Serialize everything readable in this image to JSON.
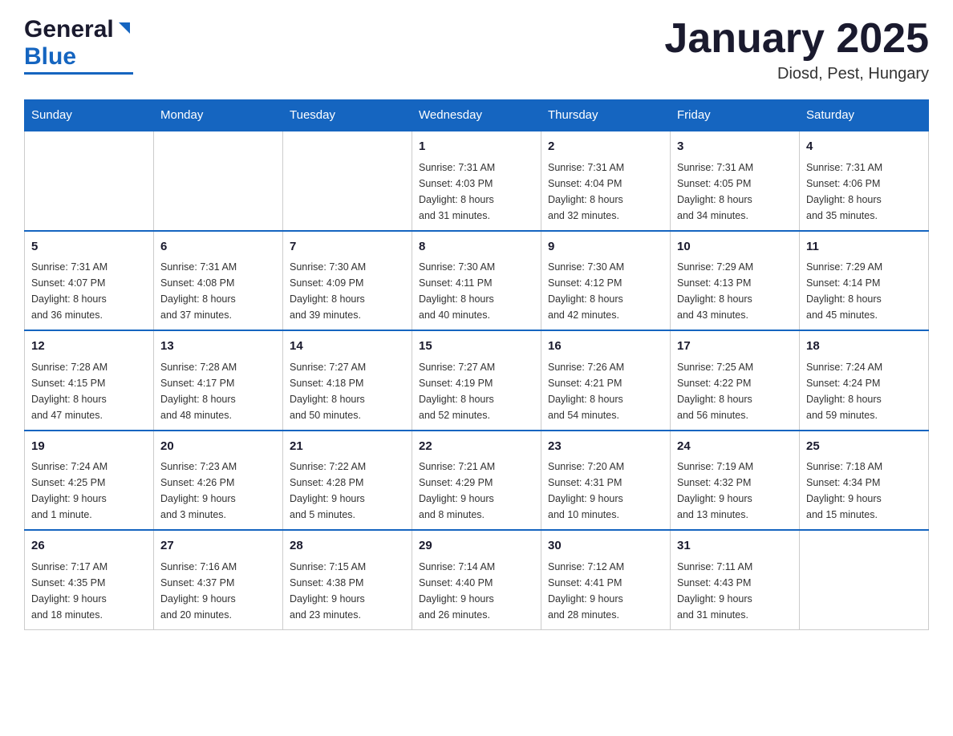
{
  "logo": {
    "general": "General",
    "blue": "Blue",
    "arrow_unicode": "▶"
  },
  "title": "January 2025",
  "subtitle": "Diosd, Pest, Hungary",
  "days_of_week": [
    "Sunday",
    "Monday",
    "Tuesday",
    "Wednesday",
    "Thursday",
    "Friday",
    "Saturday"
  ],
  "weeks": [
    {
      "cells": [
        {
          "day": "",
          "info": ""
        },
        {
          "day": "",
          "info": ""
        },
        {
          "day": "",
          "info": ""
        },
        {
          "day": "1",
          "info": "Sunrise: 7:31 AM\nSunset: 4:03 PM\nDaylight: 8 hours\nand 31 minutes."
        },
        {
          "day": "2",
          "info": "Sunrise: 7:31 AM\nSunset: 4:04 PM\nDaylight: 8 hours\nand 32 minutes."
        },
        {
          "day": "3",
          "info": "Sunrise: 7:31 AM\nSunset: 4:05 PM\nDaylight: 8 hours\nand 34 minutes."
        },
        {
          "day": "4",
          "info": "Sunrise: 7:31 AM\nSunset: 4:06 PM\nDaylight: 8 hours\nand 35 minutes."
        }
      ]
    },
    {
      "cells": [
        {
          "day": "5",
          "info": "Sunrise: 7:31 AM\nSunset: 4:07 PM\nDaylight: 8 hours\nand 36 minutes."
        },
        {
          "day": "6",
          "info": "Sunrise: 7:31 AM\nSunset: 4:08 PM\nDaylight: 8 hours\nand 37 minutes."
        },
        {
          "day": "7",
          "info": "Sunrise: 7:30 AM\nSunset: 4:09 PM\nDaylight: 8 hours\nand 39 minutes."
        },
        {
          "day": "8",
          "info": "Sunrise: 7:30 AM\nSunset: 4:11 PM\nDaylight: 8 hours\nand 40 minutes."
        },
        {
          "day": "9",
          "info": "Sunrise: 7:30 AM\nSunset: 4:12 PM\nDaylight: 8 hours\nand 42 minutes."
        },
        {
          "day": "10",
          "info": "Sunrise: 7:29 AM\nSunset: 4:13 PM\nDaylight: 8 hours\nand 43 minutes."
        },
        {
          "day": "11",
          "info": "Sunrise: 7:29 AM\nSunset: 4:14 PM\nDaylight: 8 hours\nand 45 minutes."
        }
      ]
    },
    {
      "cells": [
        {
          "day": "12",
          "info": "Sunrise: 7:28 AM\nSunset: 4:15 PM\nDaylight: 8 hours\nand 47 minutes."
        },
        {
          "day": "13",
          "info": "Sunrise: 7:28 AM\nSunset: 4:17 PM\nDaylight: 8 hours\nand 48 minutes."
        },
        {
          "day": "14",
          "info": "Sunrise: 7:27 AM\nSunset: 4:18 PM\nDaylight: 8 hours\nand 50 minutes."
        },
        {
          "day": "15",
          "info": "Sunrise: 7:27 AM\nSunset: 4:19 PM\nDaylight: 8 hours\nand 52 minutes."
        },
        {
          "day": "16",
          "info": "Sunrise: 7:26 AM\nSunset: 4:21 PM\nDaylight: 8 hours\nand 54 minutes."
        },
        {
          "day": "17",
          "info": "Sunrise: 7:25 AM\nSunset: 4:22 PM\nDaylight: 8 hours\nand 56 minutes."
        },
        {
          "day": "18",
          "info": "Sunrise: 7:24 AM\nSunset: 4:24 PM\nDaylight: 8 hours\nand 59 minutes."
        }
      ]
    },
    {
      "cells": [
        {
          "day": "19",
          "info": "Sunrise: 7:24 AM\nSunset: 4:25 PM\nDaylight: 9 hours\nand 1 minute."
        },
        {
          "day": "20",
          "info": "Sunrise: 7:23 AM\nSunset: 4:26 PM\nDaylight: 9 hours\nand 3 minutes."
        },
        {
          "day": "21",
          "info": "Sunrise: 7:22 AM\nSunset: 4:28 PM\nDaylight: 9 hours\nand 5 minutes."
        },
        {
          "day": "22",
          "info": "Sunrise: 7:21 AM\nSunset: 4:29 PM\nDaylight: 9 hours\nand 8 minutes."
        },
        {
          "day": "23",
          "info": "Sunrise: 7:20 AM\nSunset: 4:31 PM\nDaylight: 9 hours\nand 10 minutes."
        },
        {
          "day": "24",
          "info": "Sunrise: 7:19 AM\nSunset: 4:32 PM\nDaylight: 9 hours\nand 13 minutes."
        },
        {
          "day": "25",
          "info": "Sunrise: 7:18 AM\nSunset: 4:34 PM\nDaylight: 9 hours\nand 15 minutes."
        }
      ]
    },
    {
      "cells": [
        {
          "day": "26",
          "info": "Sunrise: 7:17 AM\nSunset: 4:35 PM\nDaylight: 9 hours\nand 18 minutes."
        },
        {
          "day": "27",
          "info": "Sunrise: 7:16 AM\nSunset: 4:37 PM\nDaylight: 9 hours\nand 20 minutes."
        },
        {
          "day": "28",
          "info": "Sunrise: 7:15 AM\nSunset: 4:38 PM\nDaylight: 9 hours\nand 23 minutes."
        },
        {
          "day": "29",
          "info": "Sunrise: 7:14 AM\nSunset: 4:40 PM\nDaylight: 9 hours\nand 26 minutes."
        },
        {
          "day": "30",
          "info": "Sunrise: 7:12 AM\nSunset: 4:41 PM\nDaylight: 9 hours\nand 28 minutes."
        },
        {
          "day": "31",
          "info": "Sunrise: 7:11 AM\nSunset: 4:43 PM\nDaylight: 9 hours\nand 31 minutes."
        },
        {
          "day": "",
          "info": ""
        }
      ]
    }
  ]
}
